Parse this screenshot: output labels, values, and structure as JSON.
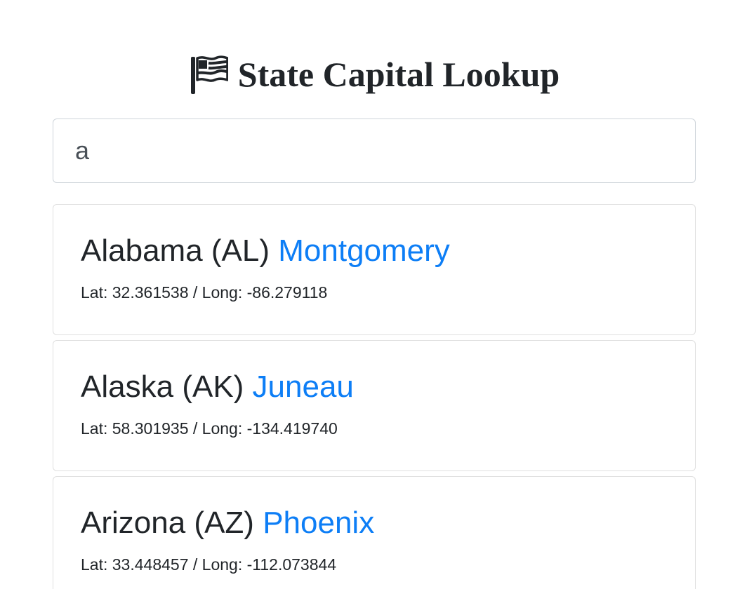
{
  "header": {
    "icon": "flag-icon",
    "title": "State Capital Lookup"
  },
  "search": {
    "value": "a",
    "placeholder": ""
  },
  "colors": {
    "text": "#212529",
    "link": "#0d7ef6",
    "border": "#ced4da"
  },
  "results": [
    {
      "state": "Alabama",
      "abbr": "(AL)",
      "capital": "Montgomery",
      "lat_label": "Lat:",
      "lat": "32.361538",
      "separator": "/",
      "long_label": "Long:",
      "long": "-86.279118"
    },
    {
      "state": "Alaska",
      "abbr": "(AK)",
      "capital": "Juneau",
      "lat_label": "Lat:",
      "lat": "58.301935",
      "separator": "/",
      "long_label": "Long:",
      "long": "-134.419740"
    },
    {
      "state": "Arizona",
      "abbr": "(AZ)",
      "capital": "Phoenix",
      "lat_label": "Lat:",
      "lat": "33.448457",
      "separator": "/",
      "long_label": "Long:",
      "long": "-112.073844"
    }
  ]
}
